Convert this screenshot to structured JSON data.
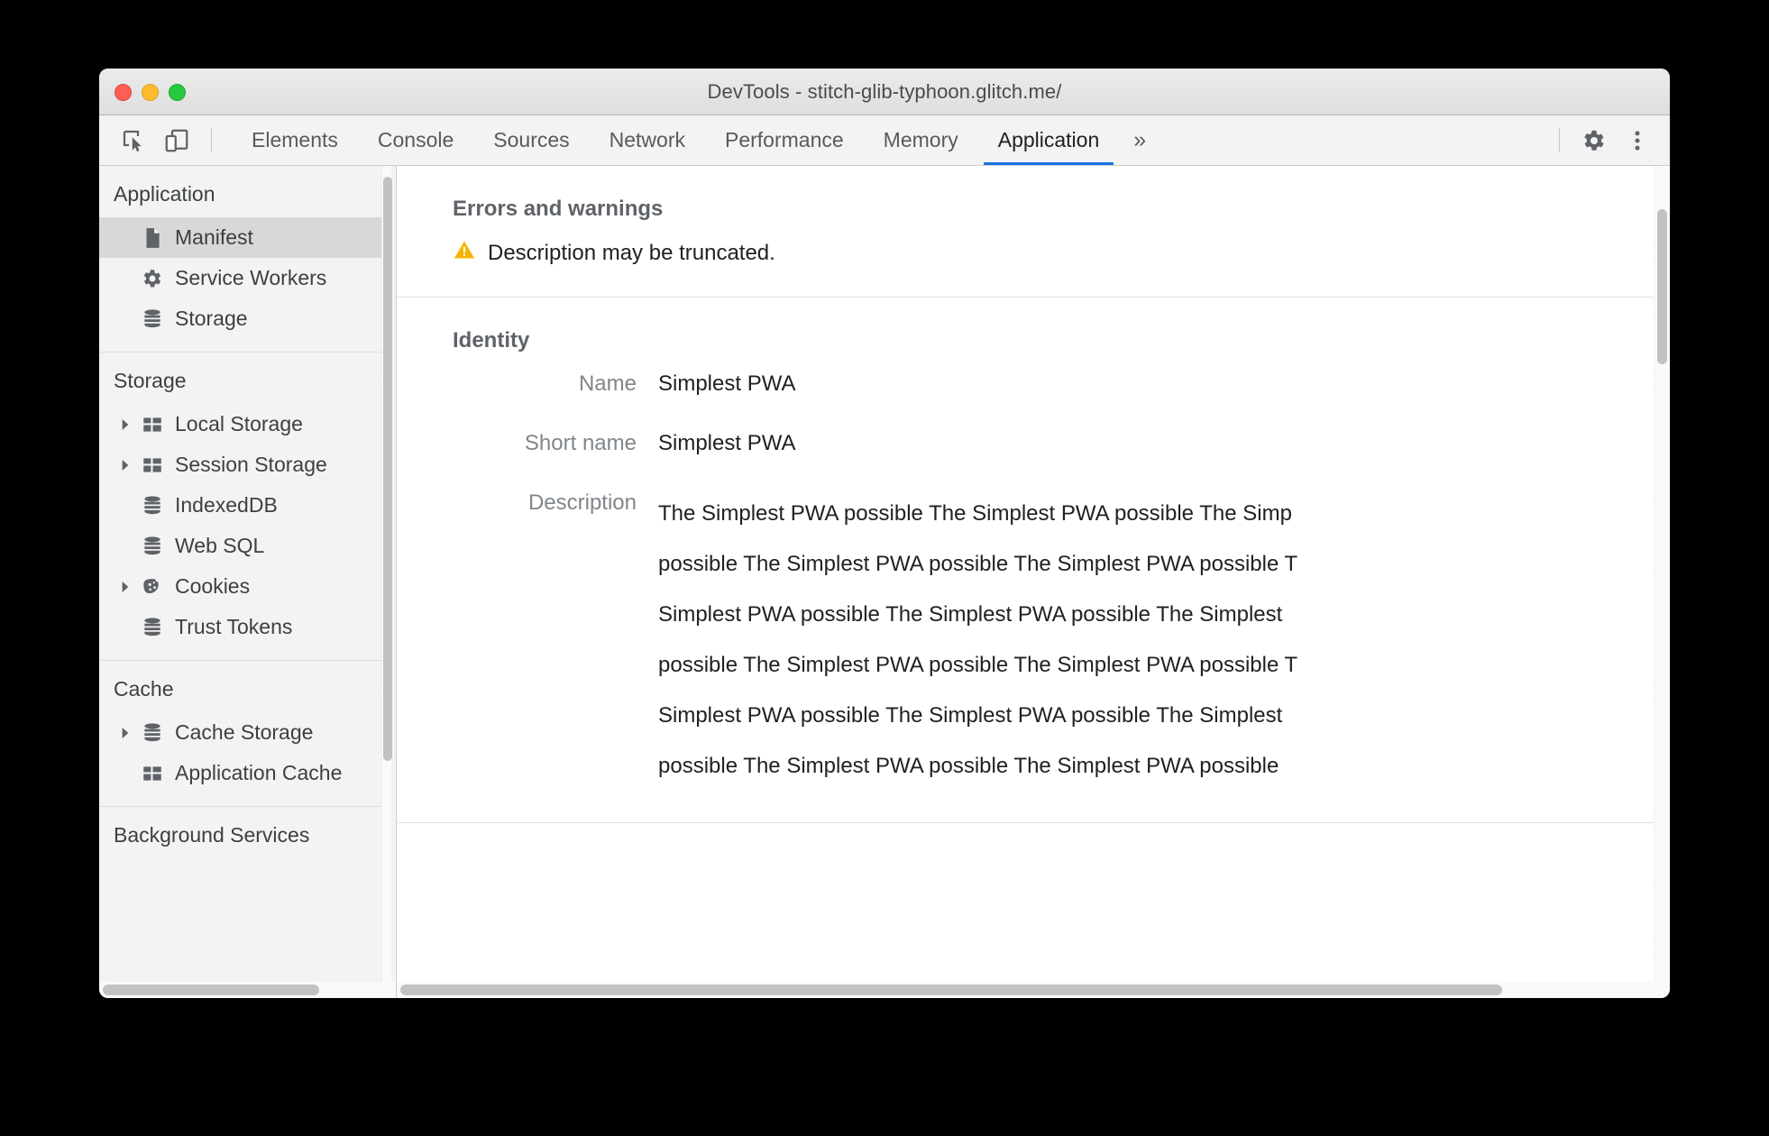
{
  "window": {
    "title": "DevTools - stitch-glib-typhoon.glitch.me/",
    "traffic_lights": [
      "close",
      "minimize",
      "zoom"
    ]
  },
  "toolbar": {
    "inspect_icon": "inspect-element-icon",
    "device_icon": "device-toolbar-icon",
    "tabs": [
      {
        "label": "Elements",
        "active": false
      },
      {
        "label": "Console",
        "active": false
      },
      {
        "label": "Sources",
        "active": false
      },
      {
        "label": "Network",
        "active": false
      },
      {
        "label": "Performance",
        "active": false
      },
      {
        "label": "Memory",
        "active": false
      },
      {
        "label": "Application",
        "active": true
      }
    ],
    "more_tabs_label": "»",
    "settings_icon": "gear-icon",
    "menu_icon": "more-vertical-icon",
    "active_tab_accent": "#1a73e8"
  },
  "sidebar": {
    "groups": [
      {
        "header": "Application",
        "items": [
          {
            "label": "Manifest",
            "icon": "document-icon",
            "arrow": false,
            "selected": true
          },
          {
            "label": "Service Workers",
            "icon": "gear-icon",
            "arrow": false,
            "selected": false
          },
          {
            "label": "Storage",
            "icon": "database-icon",
            "arrow": false,
            "selected": false
          }
        ]
      },
      {
        "header": "Storage",
        "items": [
          {
            "label": "Local Storage",
            "icon": "table-icon",
            "arrow": true,
            "selected": false
          },
          {
            "label": "Session Storage",
            "icon": "table-icon",
            "arrow": true,
            "selected": false
          },
          {
            "label": "IndexedDB",
            "icon": "database-icon",
            "arrow": false,
            "selected": false
          },
          {
            "label": "Web SQL",
            "icon": "database-icon",
            "arrow": false,
            "selected": false
          },
          {
            "label": "Cookies",
            "icon": "cookie-icon",
            "arrow": true,
            "selected": false
          },
          {
            "label": "Trust Tokens",
            "icon": "database-icon",
            "arrow": false,
            "selected": false
          }
        ]
      },
      {
        "header": "Cache",
        "items": [
          {
            "label": "Cache Storage",
            "icon": "database-icon",
            "arrow": true,
            "selected": false
          },
          {
            "label": "Application Cache",
            "icon": "table-icon",
            "arrow": false,
            "selected": false
          }
        ]
      },
      {
        "header": "Background Services",
        "items": []
      }
    ],
    "selected_background": "#d8d8d8"
  },
  "main": {
    "errors_section": {
      "title": "Errors and warnings",
      "warning_icon": "warning-triangle-icon",
      "warning_color": "#f5b400",
      "warning_text": "Description may be truncated."
    },
    "identity_section": {
      "title": "Identity",
      "fields": [
        {
          "label": "Name",
          "value": "Simplest PWA"
        },
        {
          "label": "Short name",
          "value": "Simplest PWA"
        }
      ],
      "description_label": "Description",
      "description_lines": [
        "The Simplest PWA possible The Simplest PWA possible The Simp",
        "possible The Simplest PWA possible The Simplest PWA possible T",
        "Simplest PWA possible The Simplest PWA possible The Simplest",
        "possible The Simplest PWA possible The Simplest PWA possible T",
        "Simplest PWA possible The Simplest PWA possible The Simplest",
        "possible The Simplest PWA possible The Simplest PWA possible"
      ]
    }
  }
}
